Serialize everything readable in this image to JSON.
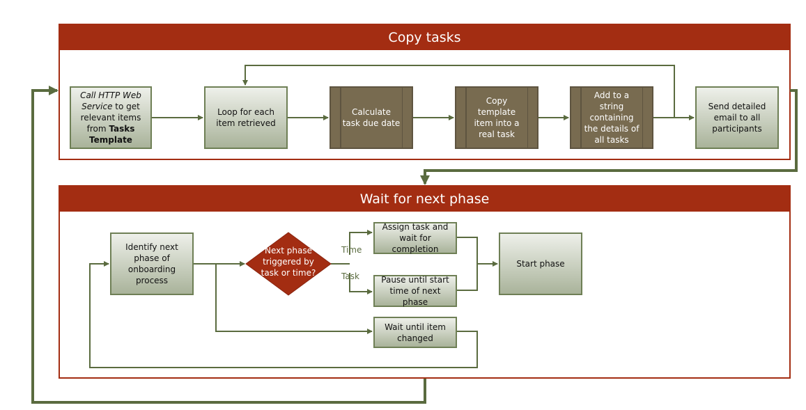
{
  "phases": [
    {
      "title": "Copy tasks"
    },
    {
      "title": "Wait for next phase"
    }
  ],
  "copy_tasks": {
    "call_http": {
      "italic": "Call HTTP Web Service",
      "rest": " to get relevant items from ",
      "bold": "Tasks Template"
    },
    "loop": "Loop for each item retrieved",
    "calc": "Calculate task due date",
    "copy": "Copy template item into a real task",
    "add": "Add to a string containing the details of all tasks",
    "send": "Send detailed email to all participants"
  },
  "wait_phase": {
    "identify": "Identify next phase of onboarding process",
    "decision": "Next phase triggered by task or time?",
    "time_label": "Time",
    "task_label": "Task",
    "assign": "Assign task and wait for completion",
    "pause": "Pause until start time of next phase",
    "wait_item": "Wait until item changed",
    "start": "Start phase"
  },
  "colors": {
    "header": "#a32d12",
    "connector": "#5a6b3f",
    "process_dark": "#786b50"
  }
}
